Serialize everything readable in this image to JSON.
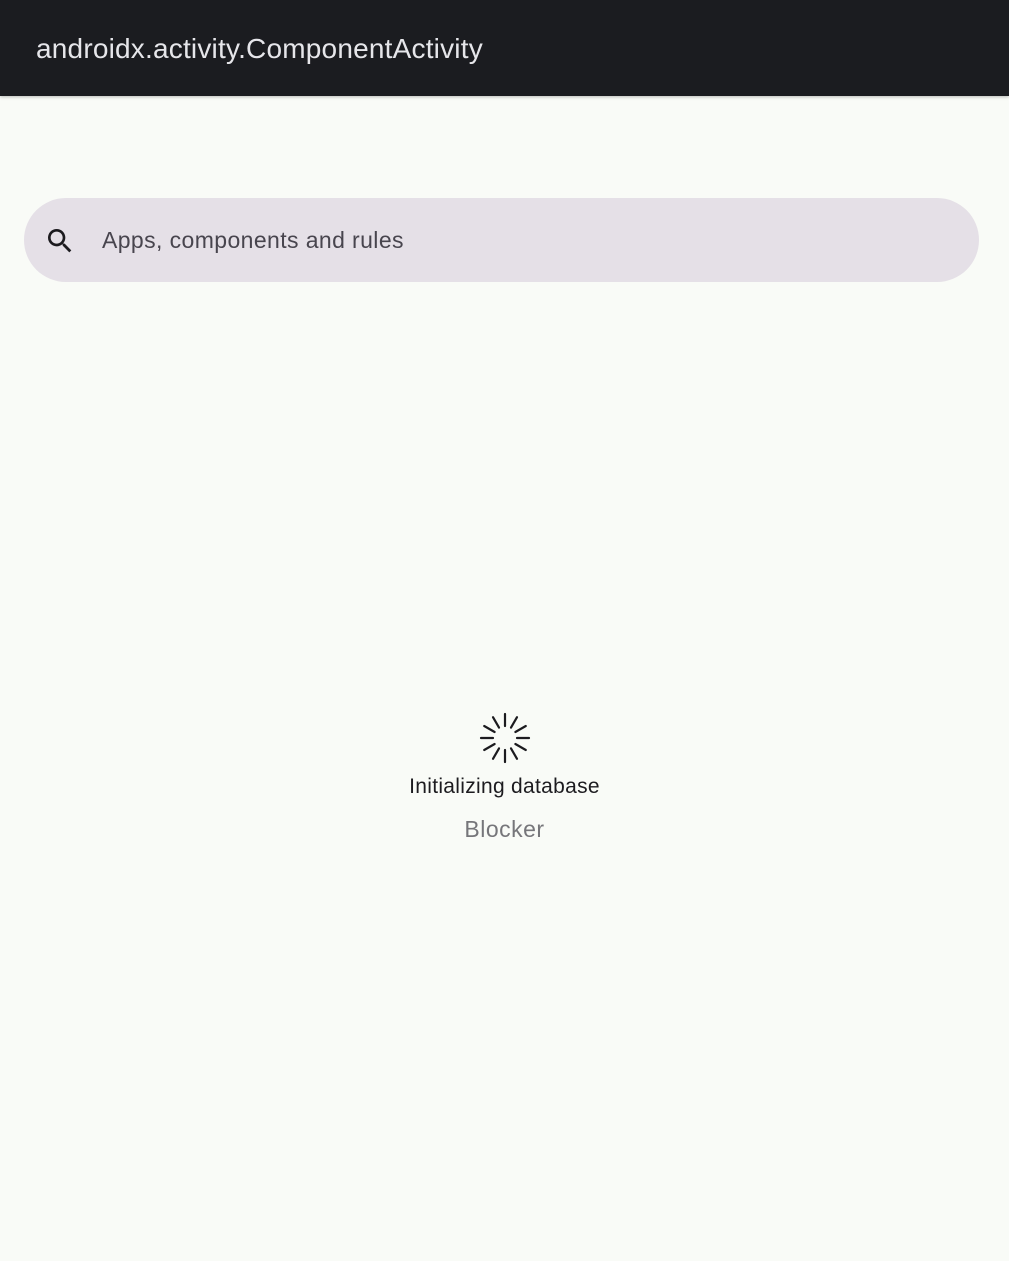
{
  "app_bar": {
    "title": "androidx.activity.ComponentActivity"
  },
  "search": {
    "placeholder": "Apps, components and rules",
    "value": "",
    "icon": "search-icon"
  },
  "loading": {
    "icon": "spinner-icon",
    "status": "Initializing database",
    "app_name": "Blocker"
  },
  "colors": {
    "app_bar_background": "#1b1c20",
    "page_background": "#f9fbf7",
    "search_background": "#e5e0e7"
  }
}
